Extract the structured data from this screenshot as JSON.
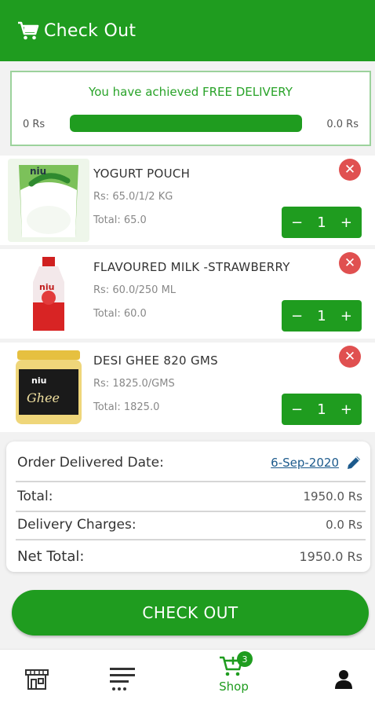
{
  "header": {
    "title": "Check Out"
  },
  "delivery": {
    "message": "You have achieved FREE DELIVERY",
    "min_label": "0 Rs",
    "max_label": "0.0 Rs",
    "progress": 1.0
  },
  "items": [
    {
      "name": "YOGURT POUCH",
      "price": "Rs: 65.0/1/2 KG",
      "total": "Total: 65.0",
      "qty": "1"
    },
    {
      "name": "FLAVOURED MILK -STRAWBERRY",
      "price": "Rs: 60.0/250 ML",
      "total": "Total: 60.0",
      "qty": "1"
    },
    {
      "name": "DESI GHEE 820 GMS",
      "price": "Rs: 1825.0/GMS",
      "total": "Total: 1825.0",
      "qty": "1"
    }
  ],
  "summary": {
    "delivered_date_label": "Order Delivered Date:",
    "delivered_date": "6-Sep-2020",
    "total_label": "Total:",
    "total_value": "1950.0 Rs",
    "delivery_label": "Delivery Charges:",
    "delivery_value": "0.0 Rs",
    "net_label": "Net Total:",
    "net_value": "1950.0 Rs"
  },
  "checkout_button": "CHECK OUT",
  "nav": {
    "shop_label": "Shop",
    "cart_count": "3"
  },
  "colors": {
    "primary": "#1f9c1f",
    "remove": "#e05050",
    "link": "#1c5a8c"
  },
  "icons": [
    "cart-icon",
    "remove-icon",
    "pencil-icon",
    "store-icon",
    "menu-icon",
    "cart-add-icon",
    "user-icon"
  ]
}
